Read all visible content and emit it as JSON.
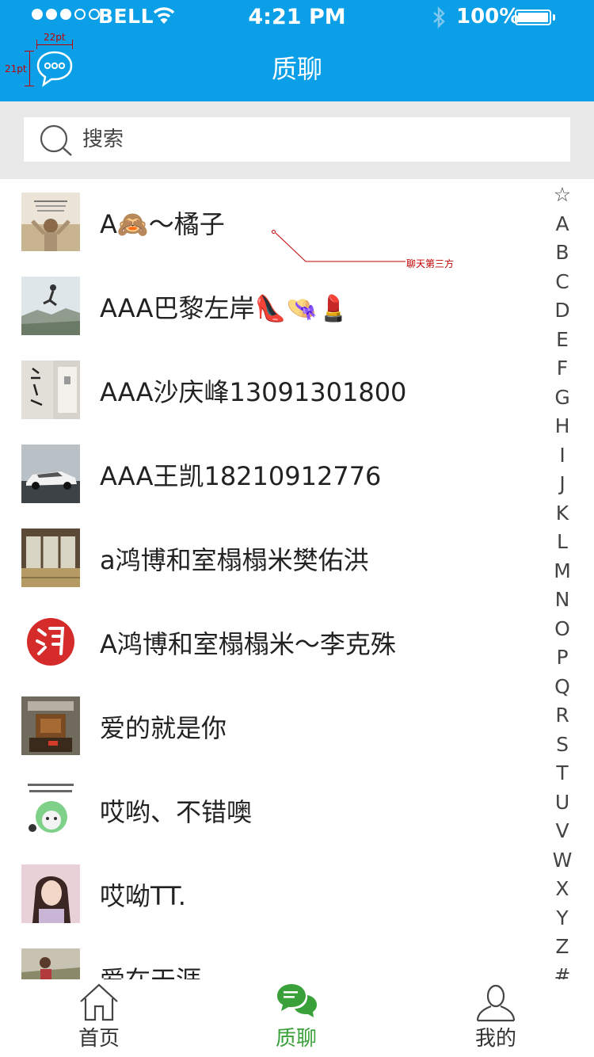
{
  "status_bar": {
    "carrier": "BELL",
    "time": "4:21 PM",
    "battery": "100%"
  },
  "header": {
    "title": "质聊"
  },
  "annotations": {
    "width_label": "22pt",
    "height_label": "21pt",
    "callout": "聊天第三方"
  },
  "search": {
    "placeholder": "搜索"
  },
  "contacts": [
    {
      "name": "A🙈～橘子"
    },
    {
      "name": "AAA巴黎左岸👠👒💄"
    },
    {
      "name": "AAA沙庆峰13091301800"
    },
    {
      "name": "AAA王凯18210912776"
    },
    {
      "name": "a鸿博和室榻榻米樊佑洪"
    },
    {
      "name": "A鸿博和室榻榻米～李克殊"
    },
    {
      "name": "爱的就是你"
    },
    {
      "name": "哎哟、不错噢"
    },
    {
      "name": "哎呦TT."
    },
    {
      "name": "爱在天涯"
    }
  ],
  "index": [
    "☆",
    "A",
    "B",
    "C",
    "D",
    "E",
    "F",
    "G",
    "H",
    "I",
    "J",
    "K",
    "L",
    "M",
    "N",
    "O",
    "P",
    "Q",
    "R",
    "S",
    "T",
    "U",
    "V",
    "W",
    "X",
    "Y",
    "Z",
    "#"
  ],
  "tabs": [
    {
      "label": "首页",
      "icon": "home-icon",
      "active": false
    },
    {
      "label": "质聊",
      "icon": "chat-bubbles-icon",
      "active": true
    },
    {
      "label": "我的",
      "icon": "profile-icon",
      "active": false
    }
  ],
  "colors": {
    "header_bg": "#0a9fe6",
    "active_tab": "#3aa03a",
    "annotation": "#c00000"
  }
}
